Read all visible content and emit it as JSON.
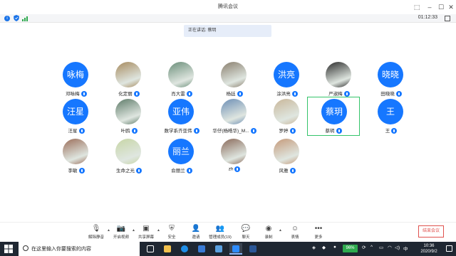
{
  "window": {
    "title": "腾讯会议"
  },
  "status": {
    "timer": "01:12:33"
  },
  "speaking_banner": "正在讲话: 蔡玥",
  "participants": [
    {
      "name": "邓咏梅",
      "avatar_text": "咏梅",
      "avatar_type": "text"
    },
    {
      "name": "化定丽",
      "avatar_text": "",
      "avatar_type": "photo",
      "photo_color": "#a78b5f"
    },
    {
      "name": "肖大雷",
      "avatar_text": "",
      "avatar_type": "photo",
      "photo_color": "#6b8f7a"
    },
    {
      "name": "杨廷",
      "avatar_text": "",
      "avatar_type": "photo",
      "photo_color": "#8a7f6e"
    },
    {
      "name": "涂洪亮",
      "avatar_text": "洪亮",
      "avatar_type": "text"
    },
    {
      "name": "严淑梅",
      "avatar_text": "",
      "avatar_type": "photo",
      "photo_color": "#2b2b2b"
    },
    {
      "name": "田晓晓",
      "avatar_text": "晓晓",
      "avatar_type": "text"
    },
    {
      "name": "汪星",
      "avatar_text": "汪星",
      "avatar_type": "text"
    },
    {
      "name": "叶鸥",
      "avatar_text": "",
      "avatar_type": "photo",
      "photo_color": "#5f7c6a"
    },
    {
      "name": "数学系齐亚伟",
      "avatar_text": "亚伟",
      "avatar_type": "text"
    },
    {
      "name": "华仔(杨晧华)_M...",
      "avatar_text": "",
      "avatar_type": "photo",
      "photo_color": "#6d8fb5"
    },
    {
      "name": "罗婷",
      "avatar_text": "",
      "avatar_type": "photo",
      "photo_color": "#c9b79a"
    },
    {
      "name": "蔡玥",
      "avatar_text": "蔡玥",
      "avatar_type": "text"
    },
    {
      "name": "王",
      "avatar_text": "王",
      "avatar_type": "text"
    },
    {
      "name": "李敏",
      "avatar_text": "",
      "avatar_type": "photo",
      "photo_color": "#9b6e5a"
    },
    {
      "name": "生命之光",
      "avatar_text": "",
      "avatar_type": "photo",
      "photo_color": "#c7d6a6"
    },
    {
      "name": "俞丽兰",
      "avatar_text": "丽兰",
      "avatar_type": "text"
    },
    {
      "name": "zh",
      "avatar_text": "",
      "avatar_type": "photo",
      "photo_color": "#8a6a5a"
    },
    {
      "name": "风雅",
      "avatar_text": "",
      "avatar_type": "photo",
      "photo_color": "#c59a7a"
    }
  ],
  "toolbar": {
    "mute": "解除静音",
    "video": "开启视频",
    "share": "共享屏幕",
    "security": "安全",
    "invite": "邀请",
    "members": "管理成员(19)",
    "chat": "聊天",
    "record": "录制",
    "reactions": "表情",
    "more": "更多",
    "end": "结束会议"
  },
  "taskbar": {
    "search_placeholder": "在这里输入你要搜索的内容",
    "battery": "96%",
    "ime": "中",
    "time": "10:36",
    "date": "2020/9/2"
  },
  "colors": {
    "accent": "#1677ff",
    "active_border": "#34c46a",
    "end": "#e0524e"
  }
}
